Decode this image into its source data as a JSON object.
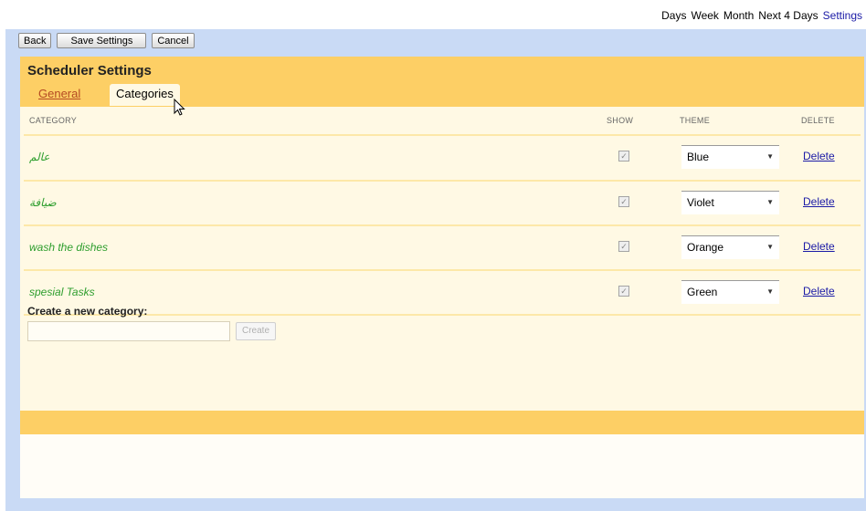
{
  "top_nav": {
    "links": [
      "Days",
      "Week",
      "Month",
      "Next 4 Days",
      "Settings"
    ],
    "active": "Settings"
  },
  "toolbar": {
    "back_label": "Back",
    "save_label": "Save Settings",
    "cancel_label": "Cancel"
  },
  "scheduler": {
    "title": "Scheduler Settings",
    "tabs": [
      {
        "label": "General",
        "active": false
      },
      {
        "label": "Categories",
        "active": true
      }
    ],
    "columns": {
      "category": "CATEGORY",
      "show": "SHOW",
      "theme": "THEME",
      "delete": "DELETE"
    },
    "categories": [
      {
        "name": "عالم",
        "show": true,
        "theme": "Blue",
        "delete_label": "Delete"
      },
      {
        "name": "ضيافة",
        "show": true,
        "theme": "Violet",
        "delete_label": "Delete"
      },
      {
        "name": "wash the dishes",
        "show": true,
        "theme": "Orange",
        "delete_label": "Delete"
      },
      {
        "name": "spesial Tasks",
        "show": true,
        "theme": "Green",
        "delete_label": "Delete"
      }
    ],
    "create": {
      "label": "Create a new category:",
      "input_value": "",
      "button_label": "Create"
    }
  },
  "colors": {
    "panel_blue": "#c9daf5",
    "header_orange": "#fdcf65",
    "content_cream": "#fff9e4",
    "category_green": "#2e9e2e",
    "link_blue": "#1a1aa6"
  }
}
